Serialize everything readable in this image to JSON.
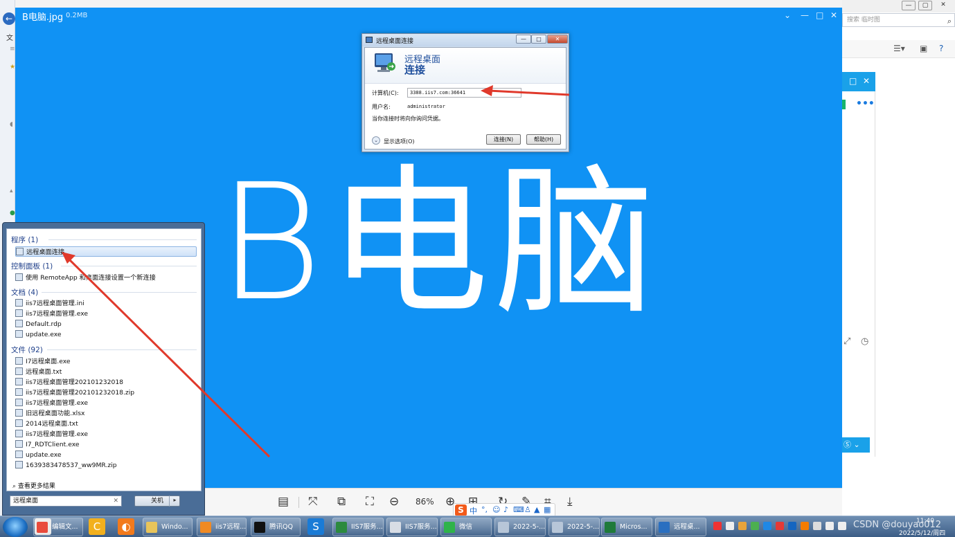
{
  "viewer": {
    "filename": "B电脑.jpg",
    "filesize": "0.2MB",
    "image_text": "B电脑",
    "zoom": "86%",
    "toolbar_icons": [
      "layout-icon",
      "fit-icon",
      "original-size-icon",
      "crop-frame-icon",
      "zoom-out-icon",
      "zoom-in-icon",
      "one-to-one-icon",
      "rotate-icon",
      "edit-icon",
      "crop-icon",
      "download-icon"
    ]
  },
  "rdp_dialog": {
    "title": "远程桌面连接",
    "banner_line1": "远程桌面",
    "banner_line2": "连接",
    "computer_label": "计算机(C):",
    "computer_value": "3388.iis7.com:36641",
    "username_label": "用户名:",
    "username_value": "administrator",
    "note": "当你连接时将向你询问凭据。",
    "options_label": "显示选项(O)",
    "connect_button": "连接(N)",
    "help_button": "帮助(H)"
  },
  "start_menu": {
    "programs_header": "程序 (1)",
    "programs": [
      "远程桌面连接"
    ],
    "control_panel_header": "控制面板 (1)",
    "control_panel": [
      "使用 RemoteApp 和桌面连接设置一个新连接"
    ],
    "documents_header": "文档 (4)",
    "documents": [
      "iis7远程桌面管理.ini",
      "iis7远程桌面管理.exe",
      "Default.rdp",
      "update.exe"
    ],
    "files_header": "文件 (92)",
    "files": [
      "I7远程桌面.exe",
      "远程桌面.txt",
      "iis7远程桌面管理202101232018",
      "iis7远程桌面管理202101232018.zip",
      "iis7远程桌面管理.exe",
      "旧远程桌面功能.xlsx",
      "2014远程桌面.txt",
      "iis7远程桌面管理.exe",
      "I7_RDTClient.exe",
      "update.exe",
      "1639383478537_ww9MR.zip"
    ],
    "more_results": "查看更多结果",
    "search_value": "远程桌面",
    "shutdown_label": "关机"
  },
  "background": {
    "search_placeholder": "搜索 临时图",
    "menu_fragment": "文"
  },
  "taskbar": {
    "tasks": [
      "编辑文...",
      "Windo...",
      "iis7远程...",
      "腾讯QQ",
      "IIS7服务...",
      "IIS7服务...",
      "微信",
      "2022-5-...",
      "2022-5-...",
      "Micros...",
      "远程桌..."
    ],
    "clock_time": "11:40",
    "clock_date": "2022/5/12/周四",
    "watermark": "CSDN @douyao012"
  },
  "ime": {
    "label": "中"
  },
  "colors": {
    "image_blue": "#1092f4",
    "arrow_red": "#e0392b",
    "dialog_title_blue": "#1e4e9c"
  }
}
